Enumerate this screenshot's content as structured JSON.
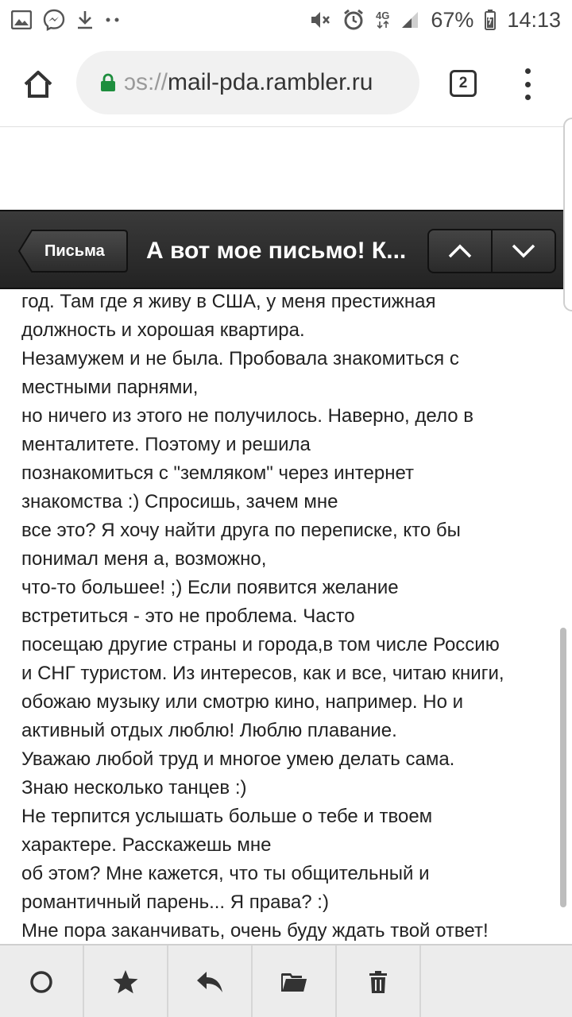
{
  "status_bar": {
    "left_icons": [
      "image-icon",
      "messenger-icon",
      "download-icon",
      "more-dots-icon"
    ],
    "right_icons": [
      "mute-icon",
      "alarm-icon",
      "network-4g-icon",
      "signal-icon",
      "battery-icon"
    ],
    "network": "4G",
    "battery": "67%",
    "time": "14:13"
  },
  "browser": {
    "url_scheme": "ɔs://",
    "url_host": "mail-pda.rambler.ru",
    "tab_count": "2",
    "lock_color": "#1e8e3e"
  },
  "mail_header": {
    "back_label": "Письма",
    "title": "А вот мое письмо! К..."
  },
  "message": {
    "lines": [
      "год. Там где я живу в США, у меня престижная",
      "должность и хорошая квартира.",
      "Незамужем и не была. Пробовала знакомиться с",
      "местными парнями,",
      "но ничего из этого не получилось. Наверно, дело в",
      "менталитете. Поэтому и решила",
      "познакомиться с \"земляком\" через интернет",
      "знакомства :) Спросишь, зачем мне",
      "все это? Я хочу найти друга по переписке, кто бы",
      "понимал меня а, возможно,",
      "что-то большее! ;) Если появится желание",
      "встретиться - это не проблема. Часто",
      "посещаю другие страны и города,в том числе Россию",
      "и СНГ туристом. Из интересов, как и все, читаю книги,",
      "обожаю музыку или смотрю кино, например. Но и",
      "активный отдых люблю! Люблю плавание.",
      "Уважаю любой труд и многое умею делать сама.",
      "Знаю несколько танцев :)",
      "Не терпится услышать больше о тебе и твоем",
      "характере. Расскажешь мне",
      "об этом? Мне кажется, что ты общительный и",
      "романтичный парень... Я права? :)",
      "Мне пора заканчивать, очень буду ждать твой ответ!"
    ]
  },
  "toolbar": {
    "items": [
      "circle-icon",
      "star-icon",
      "reply-icon",
      "folder-icon",
      "trash-icon"
    ]
  }
}
